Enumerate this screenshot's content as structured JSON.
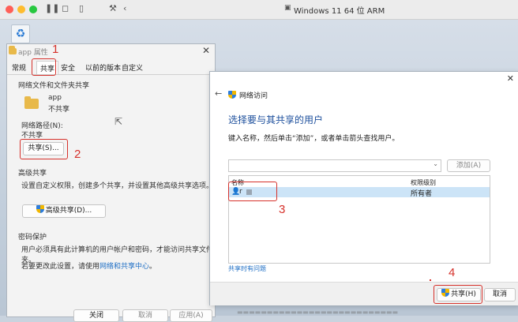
{
  "vm": {
    "title": "Windows 11 64 位 ARM",
    "toolbar_icons": [
      "sidebar-icon",
      "snapshot-icon",
      "parallel-icon",
      "settings-icon",
      "back-icon"
    ]
  },
  "colors": {
    "annotation": "#d6312b",
    "link": "#1f6fc5",
    "heading_blue": "#1c4f9c",
    "selection": "#cce4f7"
  },
  "properties": {
    "title": "app 属性",
    "tabs": [
      "常规",
      "共享",
      "安全",
      "以前的版本",
      "自定义"
    ],
    "section_network": "网络文件和文件夹共享",
    "folder_name": "app",
    "folder_status": "不共享",
    "path_label": "网络路径(N):",
    "path_value": "不共享",
    "share_button": "共享(S)...",
    "section_advanced": "高级共享",
    "advanced_desc": "设置自定义权限，创建多个共享，并设置其他高级共享选项。",
    "advanced_button": "高级共享(D)...",
    "section_password": "密码保护",
    "password_desc": "用户必须具有此计算机的用户帐户和密码，才能访问共享文件夹。",
    "password_change_prefix": "若要更改此设置，请使用",
    "password_link": "网络和共享中心",
    "password_change_suffix": "。",
    "bottom_buttons": [
      "关闭",
      "取消",
      "应用(A)"
    ]
  },
  "network_access": {
    "title": "网络访问",
    "heading": "选择要与其共享的用户",
    "instruction": "键入名称，然后单击“添加”，或者单击箭头查找用户。",
    "add_button": "添加(A)",
    "col_name": "名称",
    "col_permission": "权限级别",
    "user_name": "r",
    "user_permission": "所有者",
    "help_link": "共享时有问题",
    "share_button": "共享(H)",
    "cancel_button": "取消"
  },
  "annotations": [
    "1",
    "2",
    "3",
    "4"
  ]
}
